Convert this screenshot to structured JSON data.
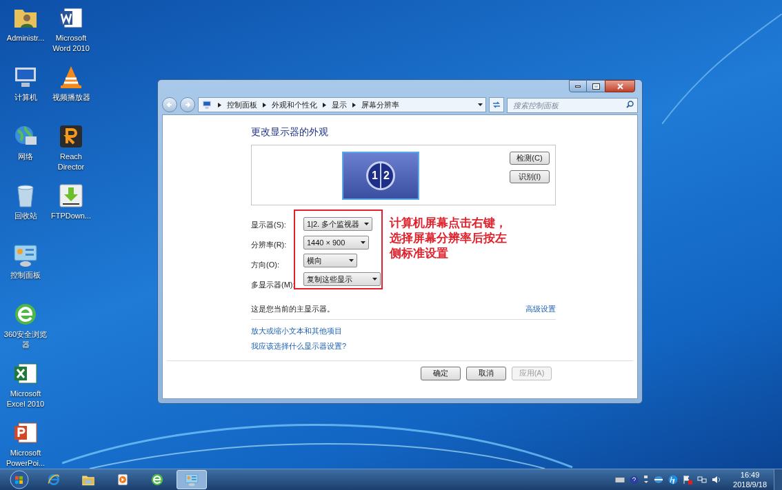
{
  "desktop_icon_columns": [
    {
      "icons": [
        {
          "label": "Administr...",
          "kind": "user-folder"
        },
        {
          "label": "计算机",
          "kind": "computer"
        },
        {
          "label": "网络",
          "kind": "network"
        },
        {
          "label": "回收站",
          "kind": "recycle"
        },
        {
          "label": "控制面板",
          "kind": "control-panel"
        },
        {
          "label": "360安全浏览器",
          "kind": "browser"
        },
        {
          "label": "Microsoft Excel 2010",
          "kind": "excel"
        },
        {
          "label": "Microsoft PowerPoi...",
          "kind": "powerpoint"
        }
      ]
    },
    {
      "icons": [
        {
          "label": "Microsoft Word 2010",
          "kind": "word"
        },
        {
          "label": "视频播放器",
          "kind": "player"
        },
        {
          "label": "Reach Director",
          "kind": "reach"
        },
        {
          "label": "FTPDown...",
          "kind": "download"
        }
      ]
    }
  ],
  "window": {
    "breadcrumb": [
      "控制面板",
      "外观和个性化",
      "显示",
      "屏幕分辨率"
    ],
    "search": {
      "placeholder": "搜索控制面板"
    },
    "heading": "更改显示器的外观",
    "monitor_numbers": [
      "1",
      "2"
    ],
    "side_buttons": [
      "检测(C)",
      "识别(I)"
    ],
    "settings": [
      {
        "label": "显示器(S):",
        "value": "1|2. 多个监视器"
      },
      {
        "label": "分辨率(R):",
        "value": "1440 × 900"
      },
      {
        "label": "方向(O):",
        "value": "横向"
      },
      {
        "label": "多显示器(M):",
        "value": "复制这些显示"
      }
    ],
    "annotation": "计算机屏幕点击右键，选择屏幕分辨率后按左侧标准设置",
    "status_text": "这是您当前的主显示器。",
    "advanced_link": "高级设置",
    "links": [
      "放大或缩小文本和其他项目",
      "我应该选择什么显示器设置?"
    ],
    "buttons": [
      {
        "label": "确定",
        "disabled": false
      },
      {
        "label": "取消",
        "disabled": false
      },
      {
        "label": "应用(A)",
        "disabled": true
      }
    ]
  },
  "taskbar": {
    "items": [
      {
        "kind": "ie",
        "selected": false
      },
      {
        "kind": "folder",
        "selected": false
      },
      {
        "kind": "media",
        "selected": false
      },
      {
        "kind": "browser",
        "selected": false
      },
      {
        "kind": "control-panel",
        "selected": true
      }
    ],
    "time": "16:49",
    "date": "2018/9/18"
  }
}
